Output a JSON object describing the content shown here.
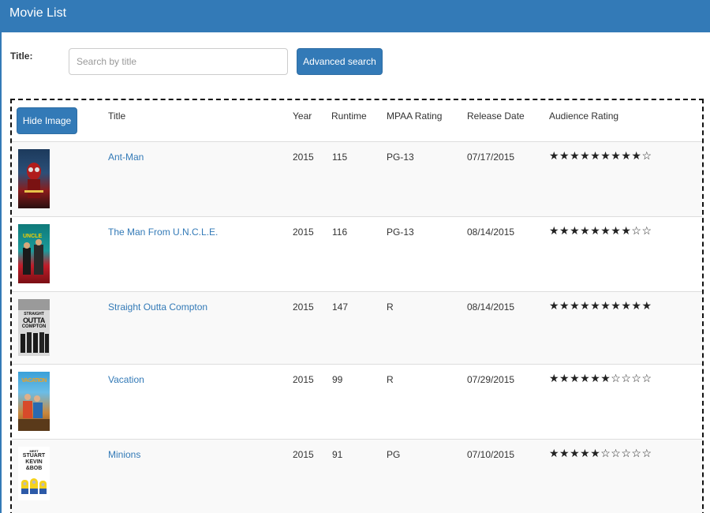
{
  "app": {
    "title": "Movie List"
  },
  "search": {
    "label": "Title:",
    "placeholder": "Search by title",
    "value": "",
    "advanced_button": "Advanced search"
  },
  "table": {
    "hide_image_button": "Hide Image",
    "columns": {
      "title": "Title",
      "year": "Year",
      "runtime": "Runtime",
      "mpaa": "MPAA Rating",
      "release": "Release Date",
      "audience": "Audience Rating"
    },
    "rows": [
      {
        "title": "Ant-Man",
        "year": "2015",
        "runtime": "115",
        "mpaa": "PG-13",
        "release": "07/17/2015",
        "stars": "★★★★★★★★★☆",
        "filled_stars": 9,
        "total_stars": 10
      },
      {
        "title": "The Man From U.N.C.L.E.",
        "year": "2015",
        "runtime": "116",
        "mpaa": "PG-13",
        "release": "08/14/2015",
        "stars": "★★★★★★★★☆☆",
        "filled_stars": 8,
        "total_stars": 10
      },
      {
        "title": "Straight Outta Compton",
        "year": "2015",
        "runtime": "147",
        "mpaa": "R",
        "release": "08/14/2015",
        "stars": "★★★★★★★★★★",
        "filled_stars": 10,
        "total_stars": 10
      },
      {
        "title": "Vacation",
        "year": "2015",
        "runtime": "99",
        "mpaa": "R",
        "release": "07/29/2015",
        "stars": "★★★★★★☆☆☆☆",
        "filled_stars": 6,
        "total_stars": 10
      },
      {
        "title": "Minions",
        "year": "2015",
        "runtime": "91",
        "mpaa": "PG",
        "release": "07/10/2015",
        "stars": "★★★★★☆☆☆☆☆",
        "filled_stars": 5,
        "total_stars": 10
      }
    ]
  },
  "posters": {
    "uncle_text": "UNCLE",
    "compton_text": [
      "STRAIGHT",
      "OUTTA",
      "COMPTON"
    ],
    "vacation_text": "VACATION",
    "minions_text": [
      "MEET",
      "STUART",
      "KEVIN",
      "&BOB"
    ]
  },
  "colors": {
    "header": "#337ab7",
    "link": "#337ab7",
    "row_alt": "#f9f9f9"
  }
}
